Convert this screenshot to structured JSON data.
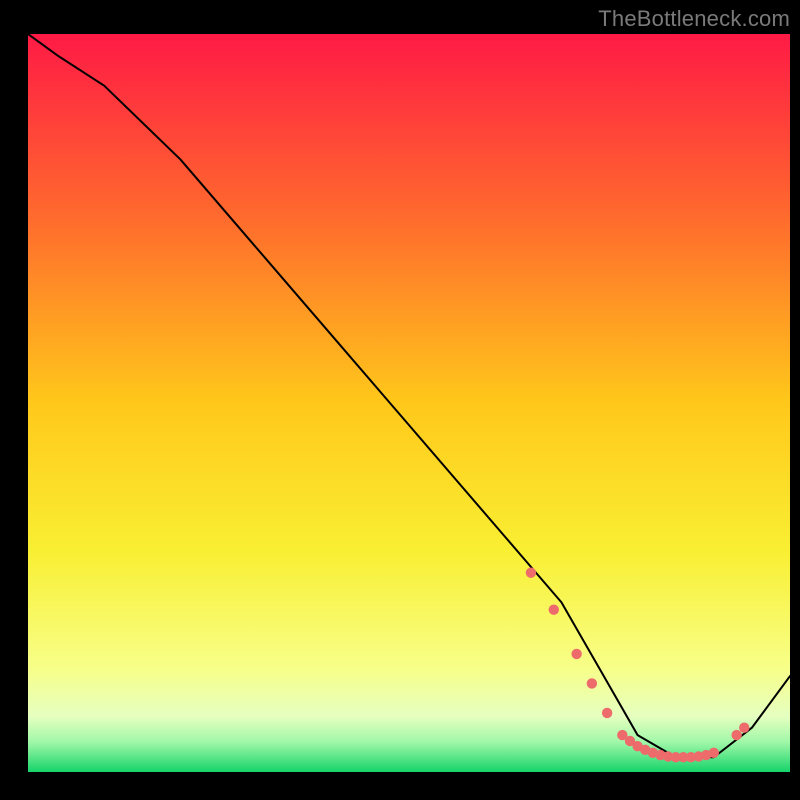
{
  "watermark": "TheBottleneck.com",
  "chart_data": {
    "type": "line",
    "title": "",
    "xlabel": "",
    "ylabel": "",
    "xlim": [
      0,
      100
    ],
    "ylim": [
      0,
      100
    ],
    "grid": false,
    "legend": false,
    "background": {
      "gradient_stops": [
        {
          "offset": 0.0,
          "color": "#ff1a45"
        },
        {
          "offset": 0.25,
          "color": "#ff6b2d"
        },
        {
          "offset": 0.5,
          "color": "#ffc81a"
        },
        {
          "offset": 0.7,
          "color": "#f9ef32"
        },
        {
          "offset": 0.86,
          "color": "#f7ff89"
        },
        {
          "offset": 0.925,
          "color": "#e5ffc0"
        },
        {
          "offset": 0.96,
          "color": "#9ef7a7"
        },
        {
          "offset": 1.0,
          "color": "#16d46a"
        }
      ]
    },
    "series": [
      {
        "name": "curve",
        "color": "#000000",
        "stroke_width": 2,
        "x": [
          0,
          4,
          10,
          20,
          35,
          50,
          65,
          70,
          75,
          80,
          85,
          90,
          95,
          100
        ],
        "y": [
          100,
          97,
          93,
          83,
          65,
          47,
          29,
          23,
          14,
          5,
          2,
          2,
          6,
          13
        ]
      }
    ],
    "points": {
      "name": "markers",
      "color": "#ee6b6b",
      "radius": 5.2,
      "x": [
        66,
        69,
        72,
        74,
        76,
        78,
        79,
        80,
        81,
        82,
        83,
        84,
        85,
        86,
        87,
        88,
        89,
        90,
        93,
        94
      ],
      "y": [
        27,
        22,
        16,
        12,
        8,
        5,
        4.2,
        3.5,
        3.0,
        2.6,
        2.3,
        2.1,
        2.0,
        2.0,
        2.0,
        2.1,
        2.3,
        2.6,
        5.0,
        6.0
      ]
    }
  }
}
